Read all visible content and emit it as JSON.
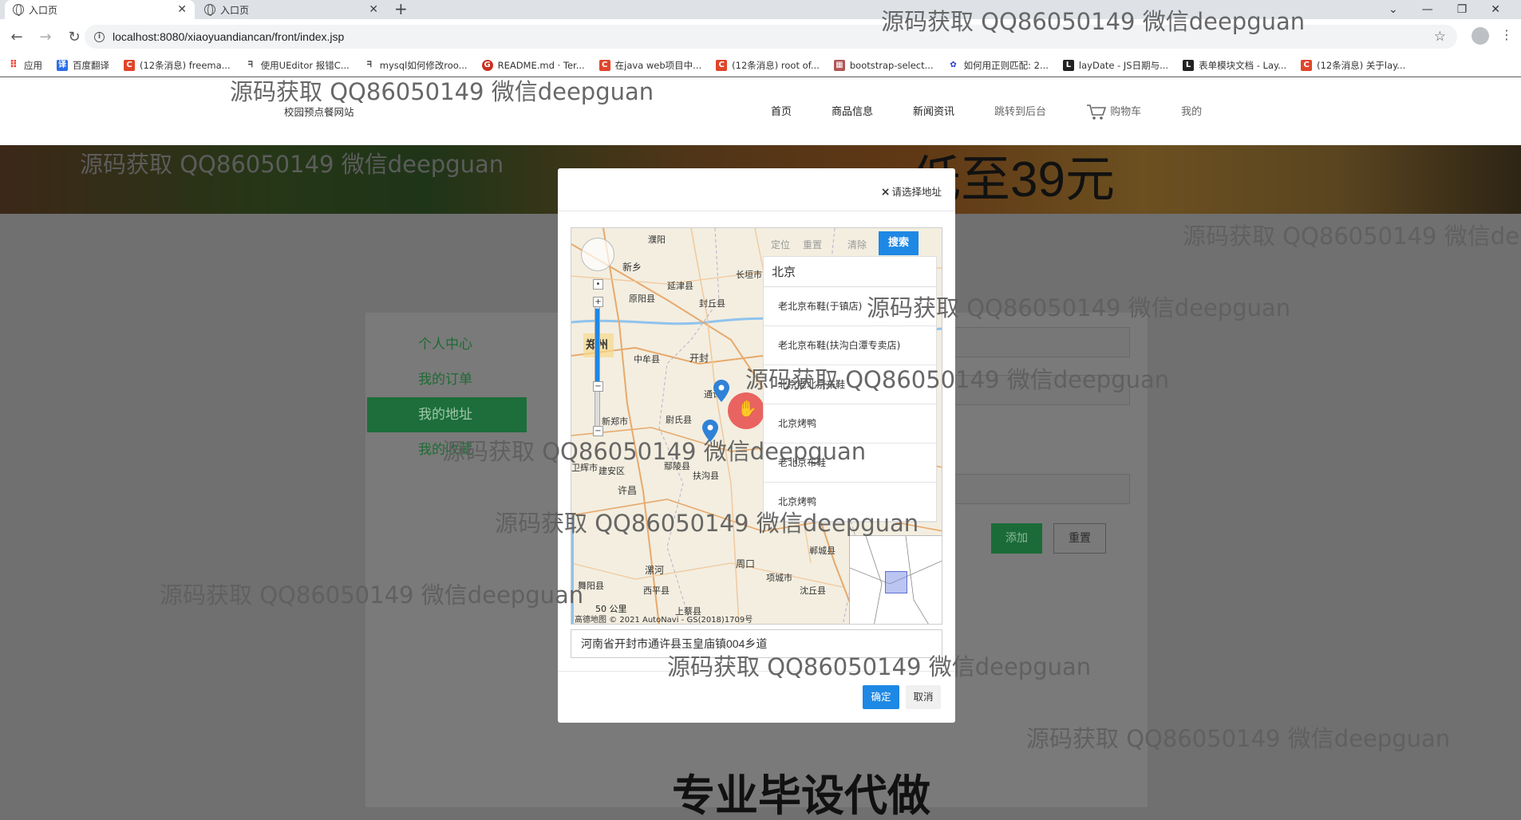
{
  "browser": {
    "tabs": [
      {
        "title": "入口页"
      },
      {
        "title": "入口页"
      }
    ],
    "new_tab": "+",
    "url": "localhost:8080/xiaoyuandiancan/front/index.jsp",
    "bookmarks": [
      {
        "label": "应用",
        "color": "#ea4335"
      },
      {
        "label": "百度翻译",
        "color": "#2b6de8"
      },
      {
        "label": "(12条消息) freema...",
        "color": "#e0452b"
      },
      {
        "label": "使用UEditor 报错C...",
        "color": "#444444"
      },
      {
        "label": "mysql如何修改roo...",
        "color": "#444444"
      },
      {
        "label": "README.md · Ter...",
        "color": "#c7311f"
      },
      {
        "label": "在java web项目中...",
        "color": "#e0452b"
      },
      {
        "label": "(12条消息) root of...",
        "color": "#e0452b"
      },
      {
        "label": "bootstrap-select...",
        "color": "#b05555"
      },
      {
        "label": "如何用正则匹配: 2...",
        "color": "#2d3bd6"
      },
      {
        "label": "layDate - JS日期与...",
        "color": "#222222"
      },
      {
        "label": "表单模块文档 - Lay...",
        "color": "#222222"
      },
      {
        "label": "(12条消息) 关于lay...",
        "color": "#e0452b"
      }
    ]
  },
  "site": {
    "name": "校园预点餐网站",
    "nav": [
      "首页",
      "商品信息",
      "新闻资讯",
      "跳转到后台",
      "购物车",
      "我的"
    ],
    "banner_text": "低至39元"
  },
  "sidebar": {
    "items": [
      {
        "label": "个人中心"
      },
      {
        "label": "我的订单"
      },
      {
        "label": "我的地址"
      },
      {
        "label": "我的收藏"
      }
    ]
  },
  "form": {
    "add_label": "添加",
    "reset_label": "重置"
  },
  "modal": {
    "title": "请选择地址",
    "close": "×",
    "search_button": "搜索",
    "search_query": "北京",
    "suggestions": [
      "老北京布鞋(于镇店)",
      "老北京布鞋(扶沟白潭专卖店)",
      "北京老北京布鞋",
      "北京烤鸭",
      "老北京布鞋",
      "北京烤鸭"
    ],
    "address": "河南省开封市通许县玉皇庙镇004乡道",
    "ok_label": "确定",
    "cancel_label": "取消",
    "map": {
      "scale": "50 公里",
      "attribution": "高德地图 © 2021 AutoNavi - GS(2018)1709号",
      "labels": [
        "新乡",
        "延津县",
        "原阳县",
        "封丘县",
        "长垣市",
        "郑州",
        "中牟县",
        "开封",
        "通许",
        "尉氏县",
        "新郑市",
        "鄢陵县",
        "扶沟县",
        "许昌",
        "漯河",
        "周口",
        "郸城县",
        "项城市",
        "沈丘县",
        "舞阳县",
        "西平县",
        "上蔡县",
        "建安区",
        "卫辉市",
        "濮阳",
        "定位",
        "重置",
        "清除"
      ]
    }
  },
  "overlays": {
    "watermark": "源码获取 QQ86050149 微信deepguan",
    "caption": "专业毕设代做"
  }
}
